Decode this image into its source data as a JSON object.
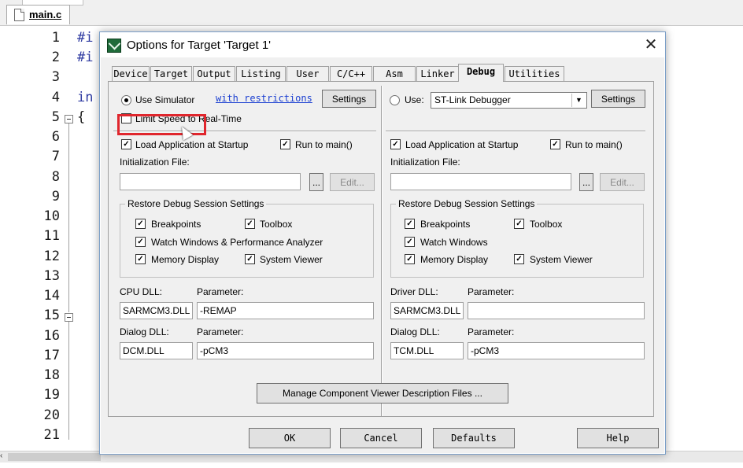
{
  "editor": {
    "file_tab": "main.c",
    "lines": [
      "1",
      "2",
      "3",
      "4",
      "5",
      "6",
      "7",
      "8",
      "9",
      "10",
      "11",
      "12",
      "13",
      "14",
      "15",
      "16",
      "17",
      "18",
      "19",
      "20",
      "21"
    ],
    "code": {
      "l1": "#i",
      "l2": "#i",
      "l4": "in",
      "l5": "{"
    }
  },
  "dialog": {
    "title": "Options for Target 'Target 1'",
    "tabs": [
      "Device",
      "Target",
      "Output",
      "Listing",
      "User",
      "C/C++",
      "Asm",
      "Linker",
      "Debug",
      "Utilities"
    ],
    "active_tab": "Debug",
    "left": {
      "use_simulator": "Use Simulator",
      "with_restrictions": "with restrictions",
      "settings": "Settings",
      "limit_speed": "Limit Speed to Real-Time",
      "load_app": "Load Application at Startup",
      "run_to_main": "Run to main()",
      "init_file": "Initialization File:",
      "browse": "...",
      "edit": "Edit...",
      "restore_group": "Restore Debug Session Settings",
      "breakpoints": "Breakpoints",
      "toolbox": "Toolbox",
      "watch_windows": "Watch Windows & Performance Analyzer",
      "memory_display": "Memory Display",
      "system_viewer": "System Viewer",
      "cpu_dll_label": "CPU DLL:",
      "cpu_param_label": "Parameter:",
      "cpu_dll": "SARMCM3.DLL",
      "cpu_param": "-REMAP",
      "dialog_dll_label": "Dialog DLL:",
      "dialog_param_label": "Parameter:",
      "dialog_dll": "DCM.DLL",
      "dialog_param": "-pCM3"
    },
    "right": {
      "use": "Use:",
      "debugger": "ST-Link Debugger",
      "settings": "Settings",
      "load_app": "Load Application at Startup",
      "run_to_main": "Run to main()",
      "init_file": "Initialization File:",
      "browse": "...",
      "edit": "Edit...",
      "restore_group": "Restore Debug Session Settings",
      "breakpoints": "Breakpoints",
      "toolbox": "Toolbox",
      "watch_windows": "Watch Windows",
      "memory_display": "Memory Display",
      "system_viewer": "System Viewer",
      "driver_dll_label": "Driver DLL:",
      "driver_param_label": "Parameter:",
      "driver_dll": "SARMCM3.DLL",
      "driver_param": "",
      "dialog_dll_label": "Dialog DLL:",
      "dialog_param_label": "Parameter:",
      "dialog_dll": "TCM.DLL",
      "dialog_param": "-pCM3"
    },
    "manage_button": "Manage Component Viewer Description Files ...",
    "buttons": {
      "ok": "OK",
      "cancel": "Cancel",
      "defaults": "Defaults",
      "help": "Help"
    },
    "check_mark": "✓",
    "close_glyph": "✕",
    "dropdown_glyph": "▼"
  },
  "colors": {
    "highlight": "#e0262d",
    "link": "#1b3fd1",
    "code_keyword": "#2e3aa1"
  }
}
